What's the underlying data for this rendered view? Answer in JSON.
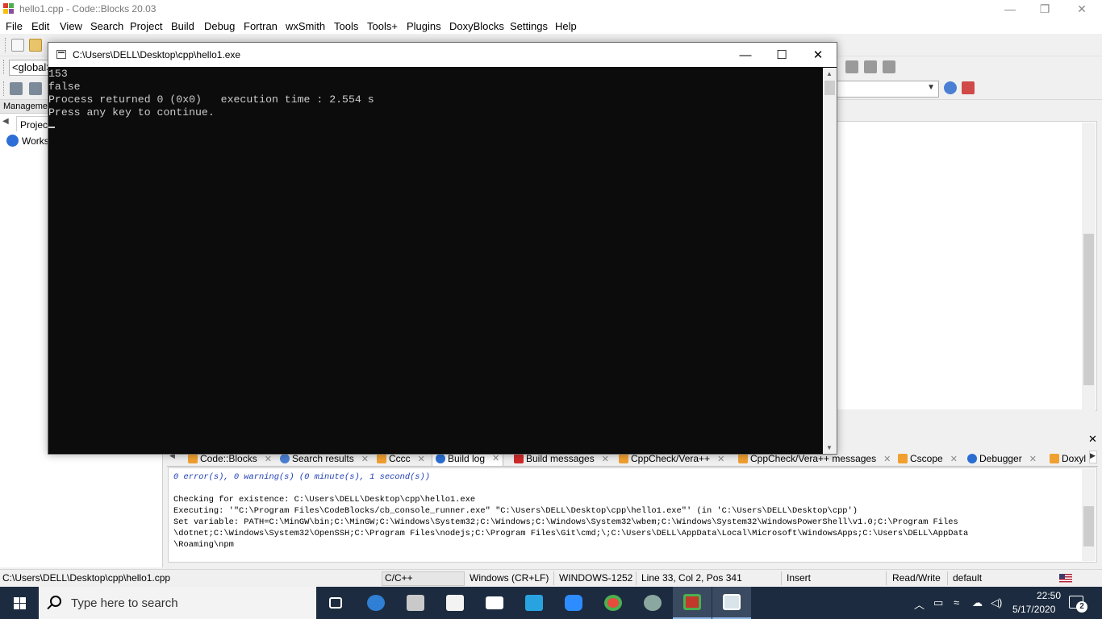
{
  "app": {
    "title": "hello1.cpp - Code::Blocks 20.03",
    "window_controls": {
      "minimize": "—",
      "restore": "❐",
      "close": "✕"
    }
  },
  "menu": [
    "File",
    "Edit",
    "View",
    "Search",
    "Project",
    "Build",
    "Debug",
    "Fortran",
    "wxSmith",
    "Tools",
    "Tools+",
    "Plugins",
    "DoxyBlocks",
    "Settings",
    "Help"
  ],
  "toolbar": {
    "global_scope_value": "<global>"
  },
  "management": {
    "header": "Management",
    "tab_label": "Projects",
    "workspace_label": "Workspace"
  },
  "console": {
    "title": "C:\\Users\\DELL\\Desktop\\cpp\\hello1.exe",
    "controls": {
      "minimize": "—",
      "maximize": "☐",
      "close": "✕"
    },
    "lines": [
      "153",
      "false",
      "Process returned 0 (0x0)   execution time : 2.554 s",
      "Press any key to continue."
    ]
  },
  "logs": {
    "close_label": "✕",
    "tabs": [
      {
        "label": "Code::Blocks",
        "icon_color": "#f0a030",
        "active": false
      },
      {
        "label": "Search results",
        "icon_color": "#4a7fd4",
        "active": false
      },
      {
        "label": "Cccc",
        "icon_color": "#f0a030",
        "active": false
      },
      {
        "label": "Build log",
        "icon_color": "#2a6dd0",
        "active": true
      },
      {
        "label": "Build messages",
        "icon_color": "#d02a2a",
        "active": false
      },
      {
        "label": "CppCheck/Vera++",
        "icon_color": "#f0a030",
        "active": false
      },
      {
        "label": "CppCheck/Vera++ messages",
        "icon_color": "#f0a030",
        "active": false
      },
      {
        "label": "Cscope",
        "icon_color": "#f0a030",
        "active": false
      },
      {
        "label": "Debugger",
        "icon_color": "#2a6dd0",
        "active": false
      },
      {
        "label": "Doxyl",
        "icon_color": "#f0a030",
        "active": false
      }
    ],
    "summary": "0 error(s), 0 warning(s) (0 minute(s), 1 second(s))",
    "lines": [
      "Checking for existence: C:\\Users\\DELL\\Desktop\\cpp\\hello1.exe",
      "Executing: '\"C:\\Program Files\\CodeBlocks/cb_console_runner.exe\" \"C:\\Users\\DELL\\Desktop\\cpp\\hello1.exe\"' (in 'C:\\Users\\DELL\\Desktop\\cpp')",
      "Set variable: PATH=C:\\MinGW\\bin;C:\\MinGW;C:\\Windows\\System32;C:\\Windows;C:\\Windows\\System32\\wbem;C:\\Windows\\System32\\WindowsPowerShell\\v1.0;C:\\Program Files",
      "\\dotnet;C:\\Windows\\System32\\OpenSSH;C:\\Program Files\\nodejs;C:\\Program Files\\Git\\cmd;\\;C:\\Users\\DELL\\AppData\\Local\\Microsoft\\WindowsApps;C:\\Users\\DELL\\AppData",
      "\\Roaming\\npm"
    ]
  },
  "statusbar": {
    "file_path": "C:\\Users\\DELL\\Desktop\\cpp\\hello1.cpp",
    "language": "C/C++",
    "line_endings": "Windows (CR+LF)",
    "encoding": "WINDOWS-1252",
    "position": "Line 33, Col 2, Pos 341",
    "mode": "Insert",
    "access": "Read/Write",
    "profile": "default"
  },
  "taskbar": {
    "search_placeholder": "Type here to search",
    "apps": [
      "task-view",
      "edge",
      "printer-app",
      "store",
      "mail",
      "photos-tiles",
      "zoom",
      "chrome",
      "network-app",
      "codeblocks",
      "console-window"
    ],
    "clock_time": "22:50",
    "clock_date": "5/17/2020",
    "notification_count": "2"
  },
  "colors": {
    "taskbar_bg": "#1c2b3f",
    "console_bg": "#0c0c0c",
    "console_fg": "#cccccc",
    "log_summary": "#1f3fb6"
  }
}
